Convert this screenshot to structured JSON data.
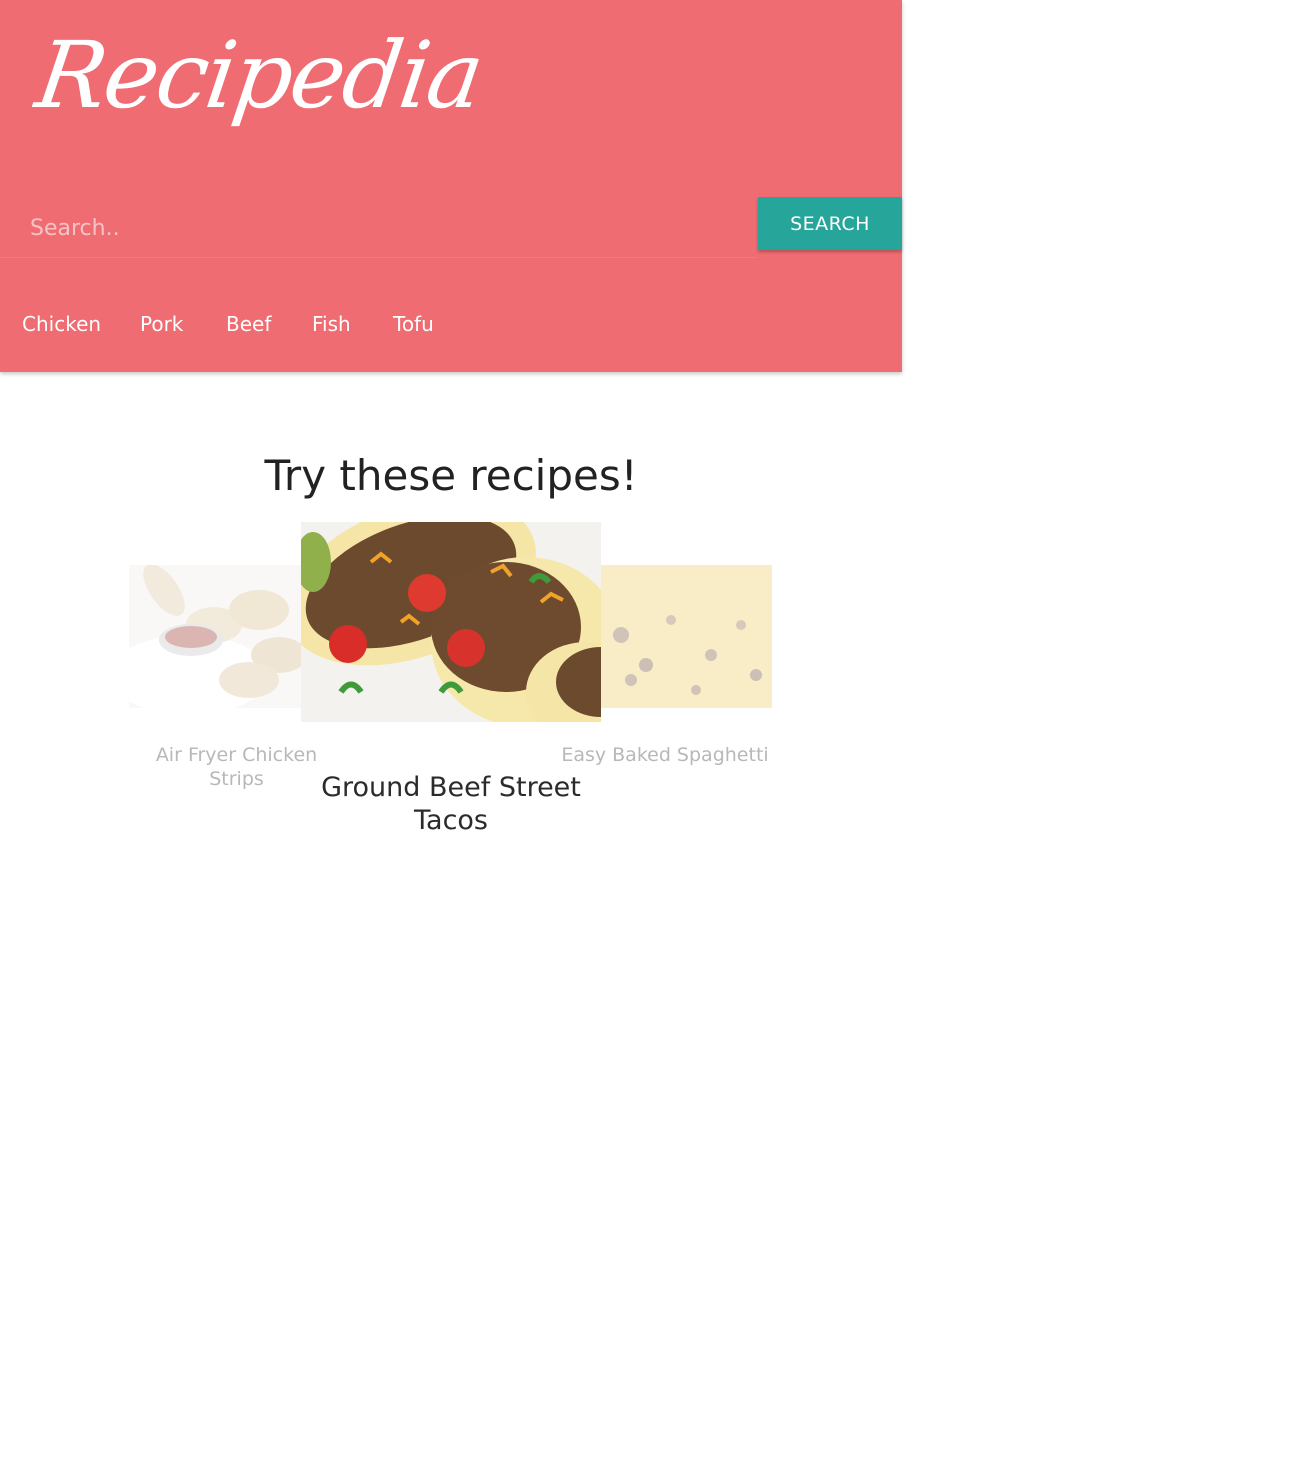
{
  "header": {
    "brand": "Recipedia",
    "background_color": "#ef6c72"
  },
  "search": {
    "placeholder": "Search..",
    "value": "",
    "button_label": "SEARCH",
    "button_color": "#26a69a"
  },
  "nav": {
    "items": [
      {
        "label": "Chicken"
      },
      {
        "label": "Pork"
      },
      {
        "label": "Beef"
      },
      {
        "label": "Fish"
      },
      {
        "label": "Tofu"
      }
    ]
  },
  "main": {
    "title": "Try these recipes!",
    "carousel": [
      {
        "title": "Air Fryer Chicken Strips",
        "image": "chicken-strips-photo",
        "state": "faded"
      },
      {
        "title": "Ground Beef Street Tacos",
        "image": "street-tacos-photo",
        "state": "active"
      },
      {
        "title": "Easy Baked Spaghetti",
        "image": "baked-spaghetti-photo",
        "state": "faded"
      }
    ]
  }
}
